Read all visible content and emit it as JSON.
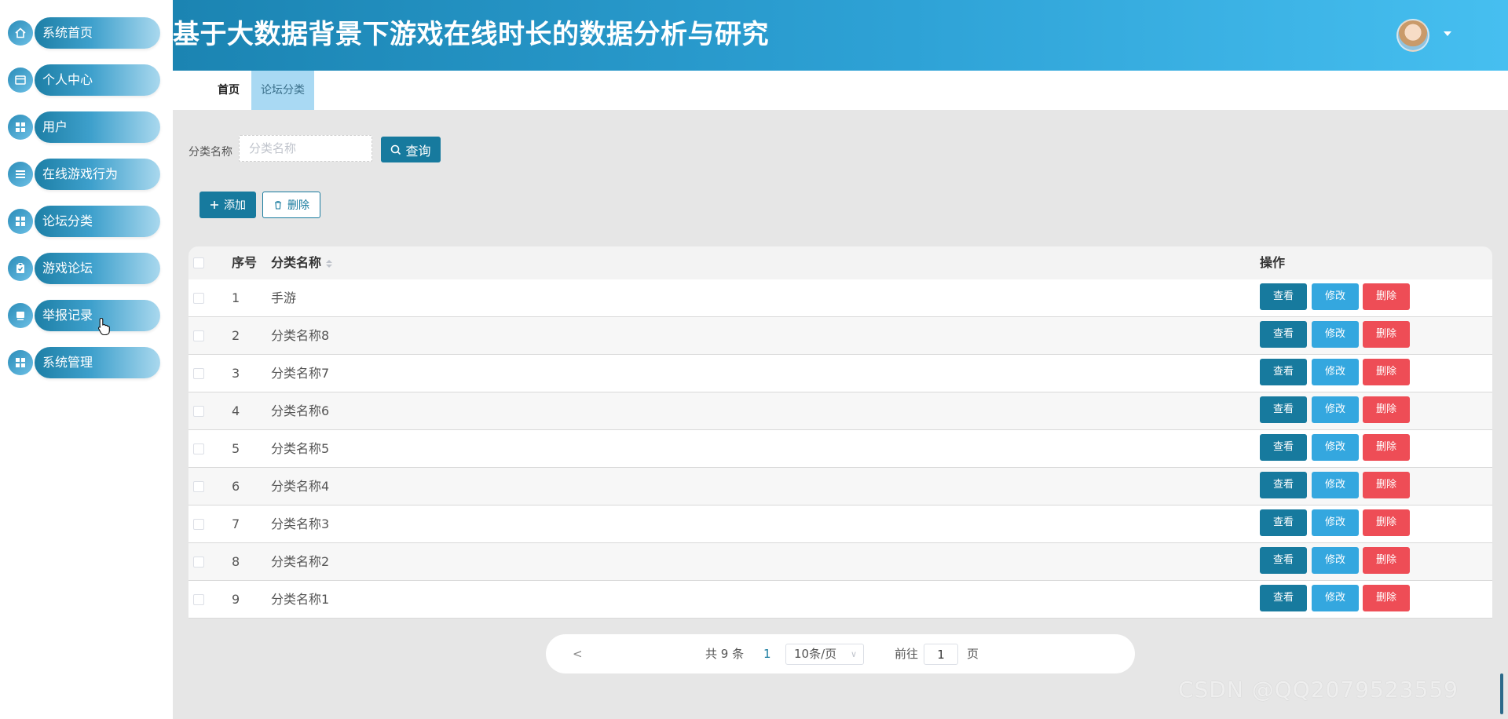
{
  "header": {
    "title": "基于大数据背景下游戏在线时长的数据分析与研究",
    "avatar_icon": "user-avatar"
  },
  "sidebar": {
    "items": [
      {
        "label": "系统首页",
        "icon": "home-icon"
      },
      {
        "label": "个人中心",
        "icon": "card-icon"
      },
      {
        "label": "用户",
        "icon": "grid-icon"
      },
      {
        "label": "在线游戏行为",
        "icon": "list-icon"
      },
      {
        "label": "论坛分类",
        "icon": "grid-icon"
      },
      {
        "label": "游戏论坛",
        "icon": "clipboard-icon"
      },
      {
        "label": "举报记录",
        "icon": "monitor-icon"
      },
      {
        "label": "系统管理",
        "icon": "grid-icon"
      }
    ]
  },
  "tabs": [
    {
      "label": "首页"
    },
    {
      "label": "论坛分类",
      "active": true
    }
  ],
  "search": {
    "label": "分类名称",
    "placeholder": "分类名称",
    "value": "",
    "button": "查询"
  },
  "toolbar": {
    "add_label": "添加",
    "delete_label": "删除"
  },
  "table": {
    "columns": [
      "序号",
      "分类名称",
      "操作"
    ],
    "rows": [
      {
        "idx": "1",
        "name": "手游"
      },
      {
        "idx": "2",
        "name": "分类名称8"
      },
      {
        "idx": "3",
        "name": "分类名称7"
      },
      {
        "idx": "4",
        "name": "分类名称6"
      },
      {
        "idx": "5",
        "name": "分类名称5"
      },
      {
        "idx": "6",
        "name": "分类名称4"
      },
      {
        "idx": "7",
        "name": "分类名称3"
      },
      {
        "idx": "8",
        "name": "分类名称2"
      },
      {
        "idx": "9",
        "name": "分类名称1"
      }
    ],
    "actions": {
      "view": "查看",
      "edit": "修改",
      "delete": "删除"
    }
  },
  "pagination": {
    "prev": "<",
    "total": "共 9 条",
    "current_page": "1",
    "page_size": "10条/页",
    "goto_label": "前往",
    "goto_value": "1",
    "goto_suffix": "页"
  },
  "watermark": "CSDN @QQ2079523559",
  "colors": {
    "primary": "#177a9e",
    "edit": "#34a7df",
    "danger": "#ee4d56",
    "header_gradient_start": "#1b84b2",
    "header_gradient_end": "#46bff0"
  }
}
